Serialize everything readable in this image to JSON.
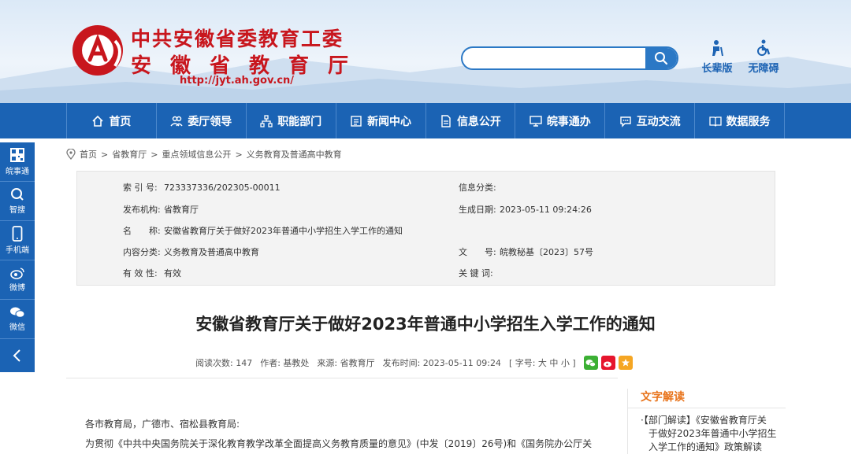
{
  "header": {
    "title_line1": "中共安徽省委教育工委",
    "title_line2": "安徽省教育厅",
    "url": "http://jyt.ah.gov.cn/",
    "search": {
      "placeholder": "",
      "value": ""
    },
    "links": [
      "长辈版",
      "无障碍"
    ]
  },
  "nav": {
    "items": [
      "首页",
      "委厅领导",
      "职能部门",
      "新闻中心",
      "信息公开",
      "皖事通办",
      "互动交流",
      "数据服务"
    ]
  },
  "sidebar": {
    "items": [
      "皖事通",
      "智搜",
      "手机端",
      "微博",
      "微信"
    ]
  },
  "breadcrumb": [
    "首页",
    "省教育厅",
    "重点领域信息公开",
    "义务教育及普通高中教育"
  ],
  "info": {
    "index_label": "索 引 号:",
    "index_value": "723337336/202305-00011",
    "category_label": "信息分类:",
    "category_value": "",
    "publisher_label": "发布机构:",
    "publisher_value": "省教育厅",
    "date_label": "生成日期:",
    "date_value": "2023-05-11 09:24:26",
    "name_label": "名　　称:",
    "name_value": "安徽省教育厅关于做好2023年普通中小学招生入学工作的通知",
    "content_label": "内容分类:",
    "content_value": "义务教育及普通高中教育",
    "doc_label": "文　　号:",
    "doc_value": "皖教秘基〔2023〕57号",
    "valid_label": "有 效 性:",
    "valid_value": "有效",
    "keywords_label": "关 键 词:",
    "keywords_value": ""
  },
  "article": {
    "title": "安徽省教育厅关于做好2023年普通中小学招生入学工作的通知",
    "reads": "阅读次数: 147",
    "author": "作者: 基教处",
    "source": "来源: 省教育厅",
    "pub_time": "发布时间: 2023-05-11 09:24",
    "font_size_ctrl": "[ 字号: 大 中 小 ]",
    "para1": "各市教育局，广德市、宿松县教育局:",
    "para2": "为贯彻《中共中央国务院关于深化教育教学改革全面提高义务教育质量的意见》(中发〔2019〕26号)和《国务院办公厅关"
  },
  "aside": {
    "heading": "文字解读",
    "line1": "·【部门解读】《安徽省教育厅关",
    "line2": "于做好2023年普通中小学招生",
    "line3": "入学工作的通知》政策解读"
  },
  "colors": {
    "brand_blue": "#1b63b4",
    "brand_red": "#c8161d",
    "accent_orange": "#e8731a"
  }
}
